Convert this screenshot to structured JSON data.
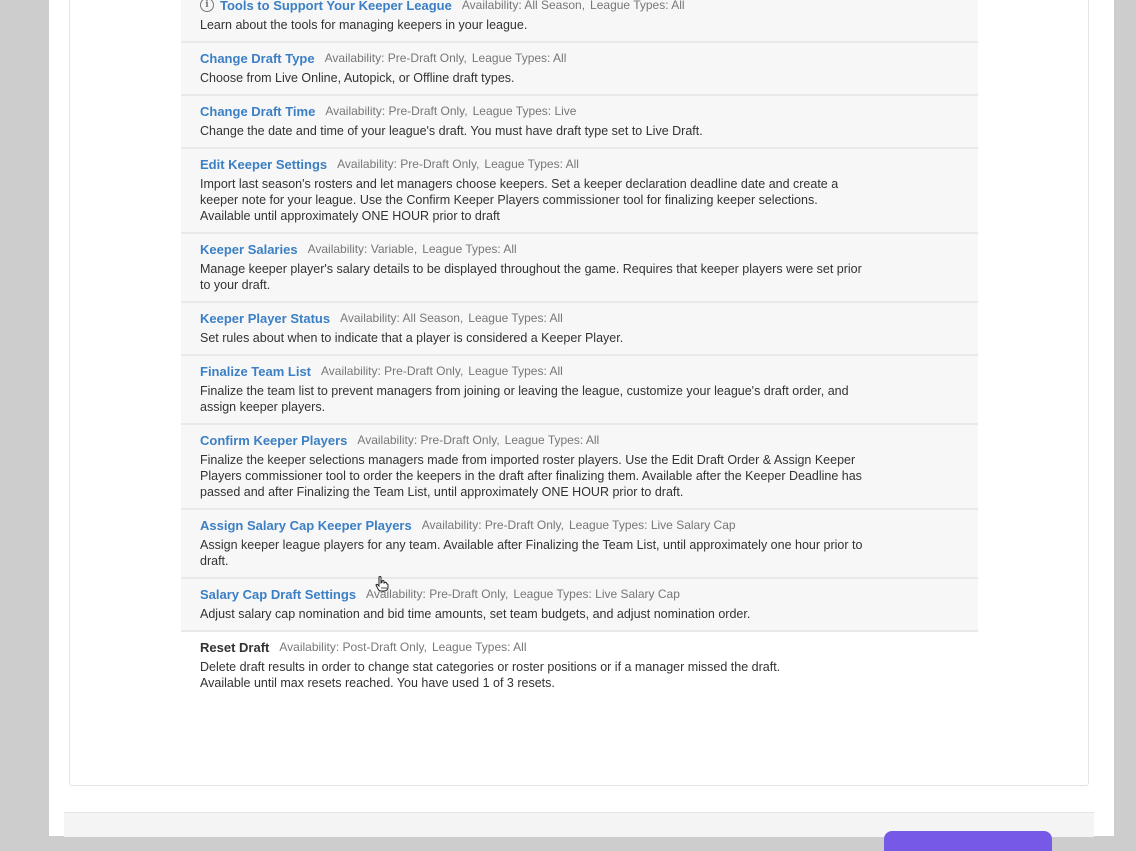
{
  "tools": [
    {
      "title": "Tools to Support Your Keeper League",
      "icon": "info-icon",
      "availability": "Availability: All Season,",
      "league_types": "League Types: All",
      "description": "Learn about the tools for managing keepers in your league.",
      "link": true
    },
    {
      "title": "Change Draft Type",
      "availability": "Availability: Pre-Draft Only,",
      "league_types": "League Types: All",
      "description": "Choose from Live Online, Autopick, or Offline draft types.",
      "link": true
    },
    {
      "title": "Change Draft Time",
      "availability": "Availability: Pre-Draft Only,",
      "league_types": "League Types: Live",
      "description": "Change the date and time of your league's draft. You must have draft type set to Live Draft.",
      "link": true
    },
    {
      "title": "Edit Keeper Settings",
      "availability": "Availability: Pre-Draft Only,",
      "league_types": "League Types: All",
      "description": "Import last season's rosters and let managers choose keepers. Set a keeper declaration deadline date and create a keeper note for your league. Use the Confirm Keeper Players commissioner tool for finalizing keeper selections. Available until approximately ONE HOUR prior to draft",
      "link": true
    },
    {
      "title": "Keeper Salaries",
      "availability": "Availability: Variable,",
      "league_types": "League Types: All",
      "description": "Manage keeper player's salary details to be displayed throughout the game. Requires that keeper players were set prior to your draft.",
      "link": true
    },
    {
      "title": "Keeper Player Status",
      "availability": "Availability: All Season,",
      "league_types": "League Types: All",
      "description": "Set rules about when to indicate that a player is considered a Keeper Player.",
      "link": true
    },
    {
      "title": "Finalize Team List",
      "availability": "Availability: Pre-Draft Only,",
      "league_types": "League Types: All",
      "description": "Finalize the team list to prevent managers from joining or leaving the league, customize your league's draft order, and assign keeper players.",
      "link": true
    },
    {
      "title": "Confirm Keeper Players",
      "availability": "Availability: Pre-Draft Only,",
      "league_types": "League Types: All",
      "description": "Finalize the keeper selections managers made from imported roster players. Use the Edit Draft Order & Assign Keeper Players commissioner tool to order the keepers in the draft after finalizing them. Available after the Keeper Deadline has passed and after Finalizing the Team List, until approximately ONE HOUR prior to draft.",
      "link": true
    },
    {
      "title": "Assign Salary Cap Keeper Players",
      "availability": "Availability: Pre-Draft Only,",
      "league_types": "League Types: Live Salary Cap",
      "description": "Assign keeper league players for any team. Available after Finalizing the Team List, until approximately one hour prior to draft.",
      "link": true
    },
    {
      "title": "Salary Cap Draft Settings",
      "availability": "Availability: Pre-Draft Only,",
      "league_types": "League Types: Live Salary Cap",
      "description": "Adjust salary cap nomination and bid time amounts, set team budgets, and adjust nomination order.",
      "link": true
    },
    {
      "title": "Reset Draft",
      "availability": "Availability: Post-Draft Only,",
      "league_types": "League Types: All",
      "description": "Delete draft results in order to change stat categories or roster positions or if a manager missed the draft.",
      "description2": "Available until max resets reached. You have used 1 of 3 resets.",
      "link": false
    }
  ],
  "colors": {
    "link": "#3b7fc4",
    "primary_button": "#7759e8"
  }
}
